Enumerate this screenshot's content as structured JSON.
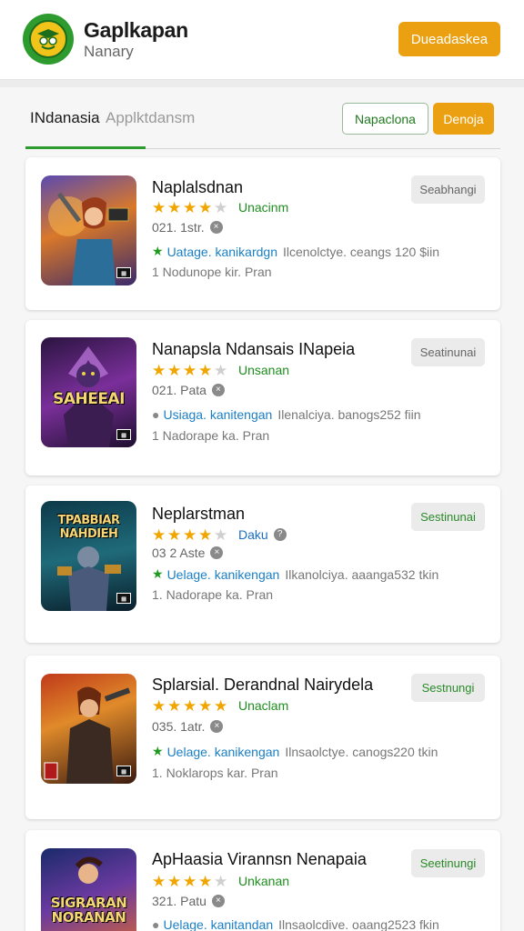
{
  "header": {
    "title": "Gaplkapan",
    "subtitle": "Nanary",
    "action_label": "Dueadaskea"
  },
  "tabs": {
    "active": "INdanasia",
    "inactive": "Applktdansm"
  },
  "toolbar": {
    "outline_label": "Napaclona",
    "orange_label": "Denoja"
  },
  "apps": [
    {
      "title": "Naplalsdnan",
      "rating_label": "Unacinm",
      "meta": "021. 1str.",
      "info_link": "Uatage. kanikardgn",
      "info_rest": "Ilcenolctye. ceangs 120 $iin",
      "foot": "1  Nodunope kir. Pran",
      "button": "Seabhangi"
    },
    {
      "title": "Nanapsla Ndansais INapeia",
      "rating_label": "Unsanan",
      "meta": "021. Pata",
      "info_link": "Usiaga. kanitengan",
      "info_rest": "Ilenalciya. banogs252 fiin",
      "foot": "1  Nadorape ka. Pran",
      "button": "Seatinunai"
    },
    {
      "title": "Neplarstman",
      "rating_label": "Daku",
      "meta": "03 2 Aste",
      "info_link": "Uelage. kanikengan",
      "info_rest": "Ilkanolciya. aaanga532 tkin",
      "foot": "1. Nadorape ka. Pran",
      "button": "Sestinunai"
    },
    {
      "title": "Splarsial. Derandnal Nairydela",
      "rating_label": "Unaclam",
      "meta": "035. 1atr.",
      "info_link": "Uelage. kanikengan",
      "info_rest": "Ilnsaolctye. canogs220 tkin",
      "foot": "1. Noklarops kar. Pran",
      "button": "Sestnungi"
    },
    {
      "title": "ApHaasia Virannsn Nenapaia",
      "rating_label": "Unkanan",
      "meta": "321. Patu",
      "info_link": "Uelage. kanitandan",
      "info_rest": "Ilnsaolcdive. oaang2523 fkin",
      "foot": "",
      "button": "Seetinungi"
    }
  ],
  "thumb_words": [
    "SAHEEAI",
    "TPABBIAR NAHDIEH",
    "SIGRARAN NORANAN"
  ],
  "colors": {
    "brand_green": "#2e9b2e",
    "accent_orange": "#eba012",
    "star": "#f0a500",
    "link_blue": "#1b7fc4"
  }
}
